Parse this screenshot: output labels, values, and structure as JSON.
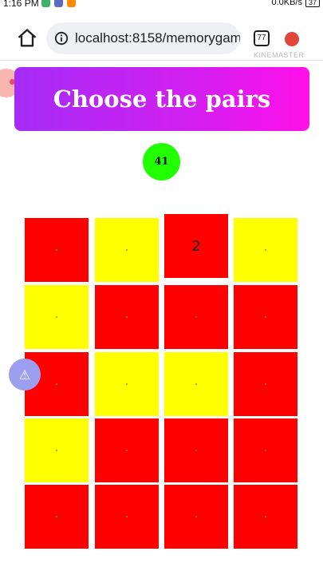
{
  "status_bar": {
    "time": "1:16 PM",
    "network_speed": "0.0KB/s",
    "battery": "37"
  },
  "browser": {
    "url": "localhost:8158/memorygame",
    "tab_count": "77",
    "watermark": "KINEMASTER"
  },
  "game": {
    "title": "Choose the pairs",
    "score": "41",
    "alert_icon": "⚠",
    "colors": {
      "red": "#ff0000",
      "yellow": "#ffff00",
      "score": "#22ff00"
    },
    "cards": [
      {
        "color": "red",
        "label": ""
      },
      {
        "color": "yellow",
        "label": ""
      },
      {
        "color": "red",
        "label": "2"
      },
      {
        "color": "yellow",
        "label": ""
      },
      {
        "color": "yellow",
        "label": ""
      },
      {
        "color": "red",
        "label": ""
      },
      {
        "color": "red",
        "label": ""
      },
      {
        "color": "red",
        "label": ""
      },
      {
        "color": "red",
        "label": ""
      },
      {
        "color": "yellow",
        "label": ""
      },
      {
        "color": "yellow",
        "label": ""
      },
      {
        "color": "red",
        "label": ""
      },
      {
        "color": "yellow",
        "label": ""
      },
      {
        "color": "red",
        "label": ""
      },
      {
        "color": "red",
        "label": ""
      },
      {
        "color": "red",
        "label": ""
      },
      {
        "color": "red",
        "label": ""
      },
      {
        "color": "red",
        "label": ""
      },
      {
        "color": "red",
        "label": ""
      },
      {
        "color": "red",
        "label": ""
      }
    ]
  }
}
